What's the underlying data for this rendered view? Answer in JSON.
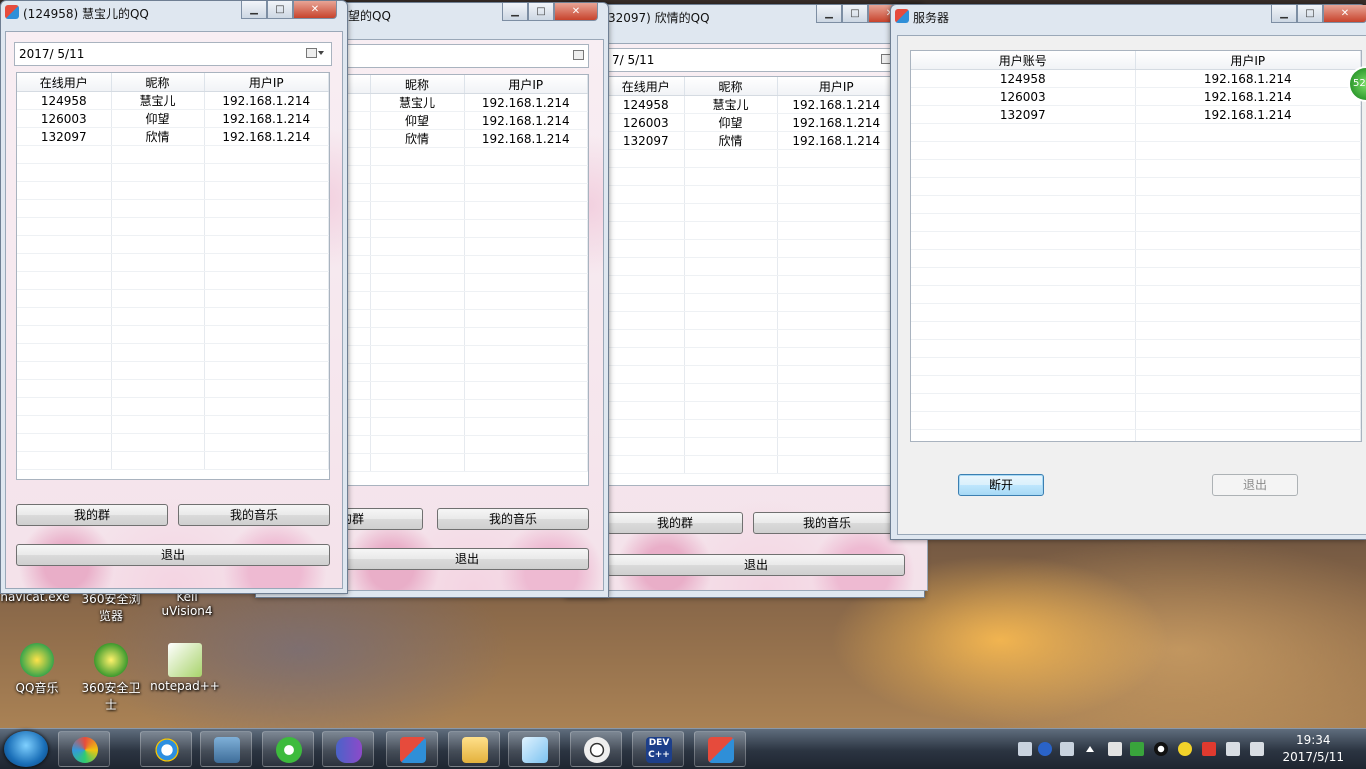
{
  "windows": [
    {
      "title": "(124958) 慧宝儿的QQ",
      "date": "2017/  5/11",
      "columns": [
        "在线用户",
        "昵称",
        "用户IP"
      ],
      "rows": [
        [
          "124958",
          "慧宝儿",
          "192.168.1.214"
        ],
        [
          "126003",
          "仰望",
          "192.168.1.214"
        ],
        [
          "132097",
          "欣情",
          "192.168.1.214"
        ]
      ],
      "btn_group": "我的群",
      "btn_music": "我的音乐",
      "btn_exit": "退出"
    },
    {
      "title": "望的QQ",
      "columns": [
        "昵称",
        "用户IP"
      ],
      "rows": [
        [
          "慧宝儿",
          "192.168.1.214"
        ],
        [
          "仰望",
          "192.168.1.214"
        ],
        [
          "欣情",
          "192.168.1.214"
        ]
      ],
      "btn_group": "的群",
      "btn_music": "我的音乐",
      "btn_exit": "退出"
    },
    {
      "title": "32097) 欣情的QQ",
      "date": "7/  5/11",
      "columns": [
        "在线用户",
        "昵称",
        "用户IP"
      ],
      "rows": [
        [
          "124958",
          "慧宝儿",
          "192.168.1.214"
        ],
        [
          "126003",
          "仰望",
          "192.168.1.214"
        ],
        [
          "132097",
          "欣情",
          "192.168.1.214"
        ]
      ],
      "btn_group": "我的群",
      "btn_music": "我的音乐",
      "btn_exit": "退出"
    }
  ],
  "server": {
    "title": "服务器",
    "columns": [
      "用户账号",
      "用户IP"
    ],
    "rows": [
      [
        "124958",
        "192.168.1.214"
      ],
      [
        "126003",
        "192.168.1.214"
      ],
      [
        "132097",
        "192.168.1.214"
      ]
    ],
    "btn_disconnect": "断开",
    "btn_exit": "退出"
  },
  "desktop_icons": {
    "partial": [
      "navicat.exe",
      "360安全浏览器",
      "Keil uVision4"
    ],
    "full": [
      "QQ音乐",
      "360安全卫士",
      "notepad++"
    ]
  },
  "edge_badge": "52",
  "taskbar_items": [
    "360-icon",
    "ie-icon",
    "monitor-icon",
    "360-update-icon",
    "infinity-icon",
    "mfc-icon",
    "folder-icon",
    "notepad-icon",
    "avatar-icon",
    "devcpp-icon",
    "mfc-icon"
  ],
  "taskbar_label_dev": "DEV",
  "taskbar_label_cpp": "C++",
  "clock": {
    "time": "19:34",
    "date": "2017/5/11"
  },
  "colors": {
    "title_bg": "#dfe7f0",
    "close_btn": "#c7432c",
    "focus_btn": "#bee6fd"
  }
}
